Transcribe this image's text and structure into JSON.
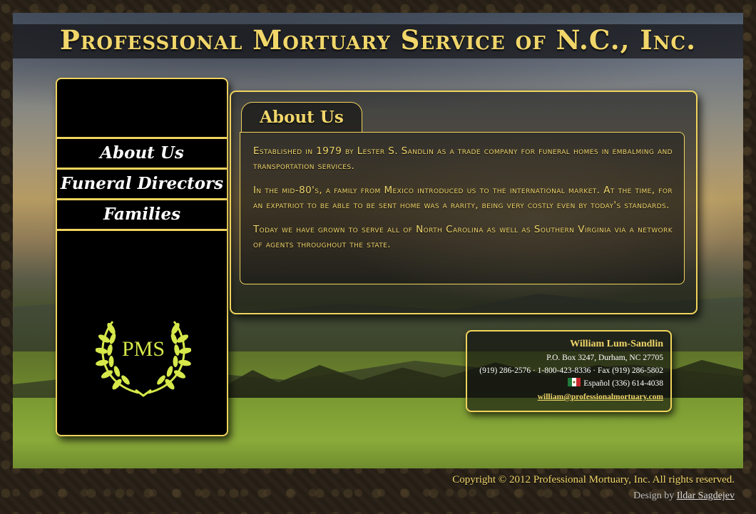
{
  "site": {
    "title": "Professional Mortuary Service of N.C., Inc."
  },
  "nav": {
    "items": [
      {
        "label": "About Us"
      },
      {
        "label": "Funeral Directors"
      },
      {
        "label": "Families"
      }
    ]
  },
  "logo": {
    "text": "PMS",
    "icon": "laurel-wreath-icon",
    "color": "#d6e84a"
  },
  "content": {
    "tab_label": "About Us",
    "paragraphs": [
      "Established in 1979 by Lester S. Sandlin as a trade company for funeral homes in embalming and transportation services.",
      "In the mid-80's, a family from Mexico introduced us to the international market. At the time, for an expatriot to be able to be sent home was a rarity, being very costly even by today's standards.",
      "Today we have grown to serve all of North Carolina as well as Southern Virginia via a network of agents throughout the state."
    ]
  },
  "contact": {
    "name": "William Lum-Sandlin",
    "address": "P.O. Box 3247, Durham, NC 27705",
    "phones": "(919) 286-2576 · 1-800-423-8336 · Fax (919) 286-5802",
    "spanish": "Español (336) 614-4038",
    "spanish_icon": "mexico-flag-icon",
    "email": "william@professionalmortuary.com"
  },
  "footer": {
    "copyright": "Copyright © 2012 Professional Mortuary, Inc. All rights reserved.",
    "design_prefix": "Design by",
    "designer": "Ildar Sagdejev"
  },
  "colors": {
    "accent": "#f0d45c",
    "panel": "#000000"
  }
}
